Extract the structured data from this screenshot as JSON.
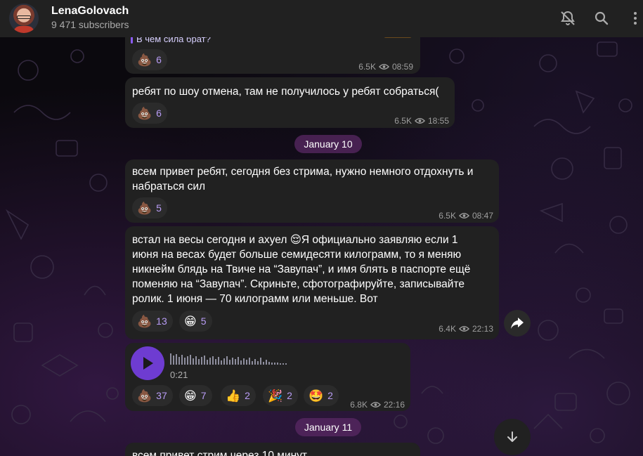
{
  "header": {
    "channel_name": "LenaGolovach",
    "subscribers": "9 471 subscribers",
    "icons": [
      "bell-off-icon",
      "search-icon",
      "more-vertical-icon"
    ]
  },
  "messages": [
    {
      "text": "В чем сила брат?",
      "reactions": [
        {
          "emoji": "💩",
          "count": "6"
        }
      ],
      "views": "6.5K",
      "time": "08:59"
    },
    {
      "text": "ребят по шоу отмена, там не получилось у ребят собраться(",
      "reactions": [
        {
          "emoji": "💩",
          "count": "6"
        }
      ],
      "views": "6.5K",
      "time": "18:55"
    },
    {
      "text_lines": [
        "всем привет ребят, сегодня без стрима, нужно немного отдохнуть и",
        "набраться сил"
      ],
      "reactions": [
        {
          "emoji": "💩",
          "count": "5"
        }
      ],
      "views": "6.5K",
      "time": "08:47"
    },
    {
      "text_lines": [
        "встал на весы сегодня и ахуел 😌Я официально заявляю если 1",
        "июня на весах будет больше семидесяти килограмм, то я меняю",
        "никнейм блядь на Твиче на “Завупач”, и имя блять в паспорте ещё",
        "поменяю на “Завупач”. Скриньте, сфотографируйте, записывайте",
        "ролик. 1 июня — 70 килограмм или меньше. Вот"
      ],
      "reactions": [
        {
          "emoji": "💩",
          "count": "13"
        },
        {
          "emoji": "😁",
          "count": "5"
        }
      ],
      "views": "6.4K",
      "time": "22:13"
    },
    {
      "voice_duration": "0:21",
      "reactions": [
        {
          "emoji": "💩",
          "count": "37"
        },
        {
          "emoji": "😁",
          "count": "7"
        },
        {
          "emoji": "👍",
          "count": "2"
        },
        {
          "emoji": "🎉",
          "count": "2"
        },
        {
          "emoji": "🤩",
          "count": "2"
        }
      ],
      "views": "6.8K",
      "time": "22:16"
    },
    {
      "text": "всем привет стрим через 10 минут"
    }
  ],
  "dates": [
    "January 10",
    "January 11"
  ],
  "colors": {
    "header_bg": "#212121",
    "bubble_bg": "#212121",
    "accent": "#6e3cd1",
    "reaction_count": "#b89cf5",
    "date_pill": "#5a2864"
  }
}
